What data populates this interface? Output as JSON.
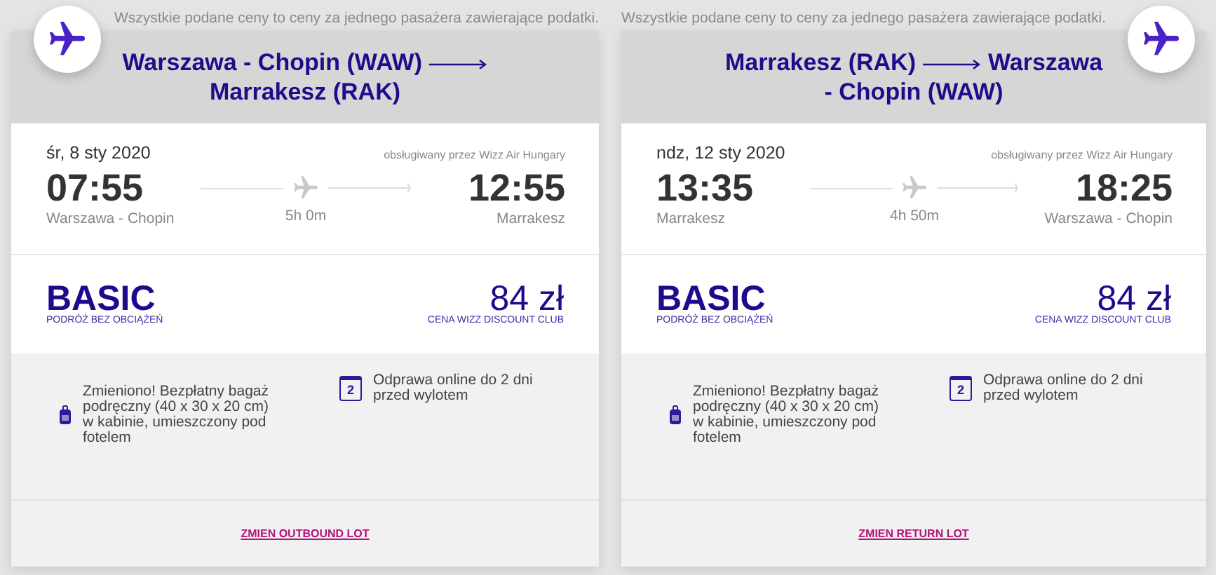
{
  "flights": [
    {
      "notice": "Wszystkie podane ceny to ceny za jednego pasażera zawierające podatki.",
      "badge_right": false,
      "route_from": "Warszawa - Chopin (WAW)",
      "route_to": "Marrakesz (RAK)",
      "date": "śr, 8 sty 2020",
      "operator": "obsługiwany przez Wizz Air Hungary",
      "depart_time": "07:55",
      "depart_place": "Warszawa - Chopin",
      "duration": "5h 0m",
      "arrive_time": "12:55",
      "arrive_place": "Marrakesz",
      "fare_name": "BASIC",
      "fare_subtitle": "PODRÓŻ BEZ OBCIĄŻEŃ",
      "price": "84 zł",
      "price_note": "CENA WIZZ DISCOUNT CLUB",
      "features": [
        {
          "kind": "bag",
          "text": "Zmieniono! Bezpłatny bagaż podręczny (40 x 30 x 20 cm) w kabinie, umieszczony pod fotelem"
        },
        {
          "kind": "calendar",
          "icon_text": "2",
          "text": "Odprawa online do 2 dni przed wylotem"
        }
      ],
      "change_link": "ZMIEN OUTBOUND LOT"
    },
    {
      "notice": "Wszystkie podane ceny to ceny za jednego pasażera zawierające podatki.",
      "badge_right": true,
      "route_from": "Marrakesz (RAK)",
      "route_to": "Warszawa - Chopin (WAW)",
      "date": "ndz, 12 sty 2020",
      "operator": "obsługiwany przez Wizz Air Hungary",
      "depart_time": "13:35",
      "depart_place": "Marrakesz",
      "duration": "4h 50m",
      "arrive_time": "18:25",
      "arrive_place": "Warszawa - Chopin",
      "fare_name": "BASIC",
      "fare_subtitle": "PODRÓŻ BEZ OBCIĄŻEŃ",
      "price": "84 zł",
      "price_note": "CENA WIZZ DISCOUNT CLUB",
      "features": [
        {
          "kind": "bag",
          "text": "Zmieniono! Bezpłatny bagaż podręczny (40 x 30 x 20 cm) w kabinie, umieszczony pod fotelem"
        },
        {
          "kind": "calendar",
          "icon_text": "2",
          "text": "Odprawa online do 2 dni przed wylotem"
        }
      ],
      "change_link": "ZMIEN RETURN LOT"
    }
  ]
}
